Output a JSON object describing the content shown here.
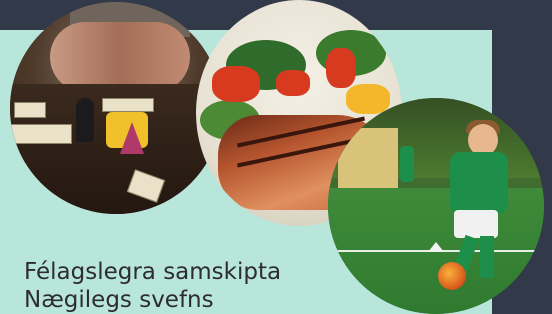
{
  "captions": {
    "line1": "Félagslegra samskipta",
    "line2": "Nægilegs svefns"
  },
  "photos": [
    {
      "subject": "board-game-photo"
    },
    {
      "subject": "salmon-salad-photo"
    },
    {
      "subject": "child-football-photo"
    }
  ],
  "colors": {
    "background": "#323a4a",
    "panel": "#b8e6da",
    "text": "#2d2d2d"
  }
}
